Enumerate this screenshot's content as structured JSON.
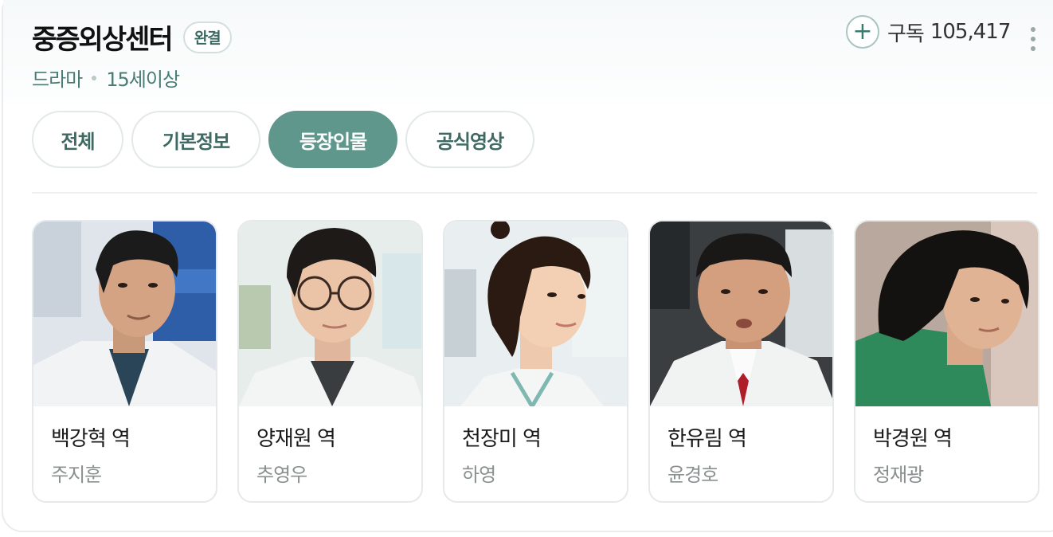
{
  "header": {
    "title": "중증외상센터",
    "badge": "완결",
    "genre": "드라마",
    "rating": "15세이상",
    "subscribe_label": "구독",
    "subscribe_count": "105,417"
  },
  "tabs": [
    {
      "label": "전체",
      "active": false
    },
    {
      "label": "기본정보",
      "active": false
    },
    {
      "label": "등장인물",
      "active": true
    },
    {
      "label": "공식영상",
      "active": false
    }
  ],
  "cast": [
    {
      "role": "백강혁 역",
      "actor": "주지훈"
    },
    {
      "role": "양재원 역",
      "actor": "추영우"
    },
    {
      "role": "천장미 역",
      "actor": "하영"
    },
    {
      "role": "한유림 역",
      "actor": "윤경호"
    },
    {
      "role": "박경원 역",
      "actor": "정재광"
    }
  ],
  "colors": {
    "accent": "#5f978c",
    "tab_text": "#3f6a64",
    "meta_text": "#4a7b73"
  }
}
